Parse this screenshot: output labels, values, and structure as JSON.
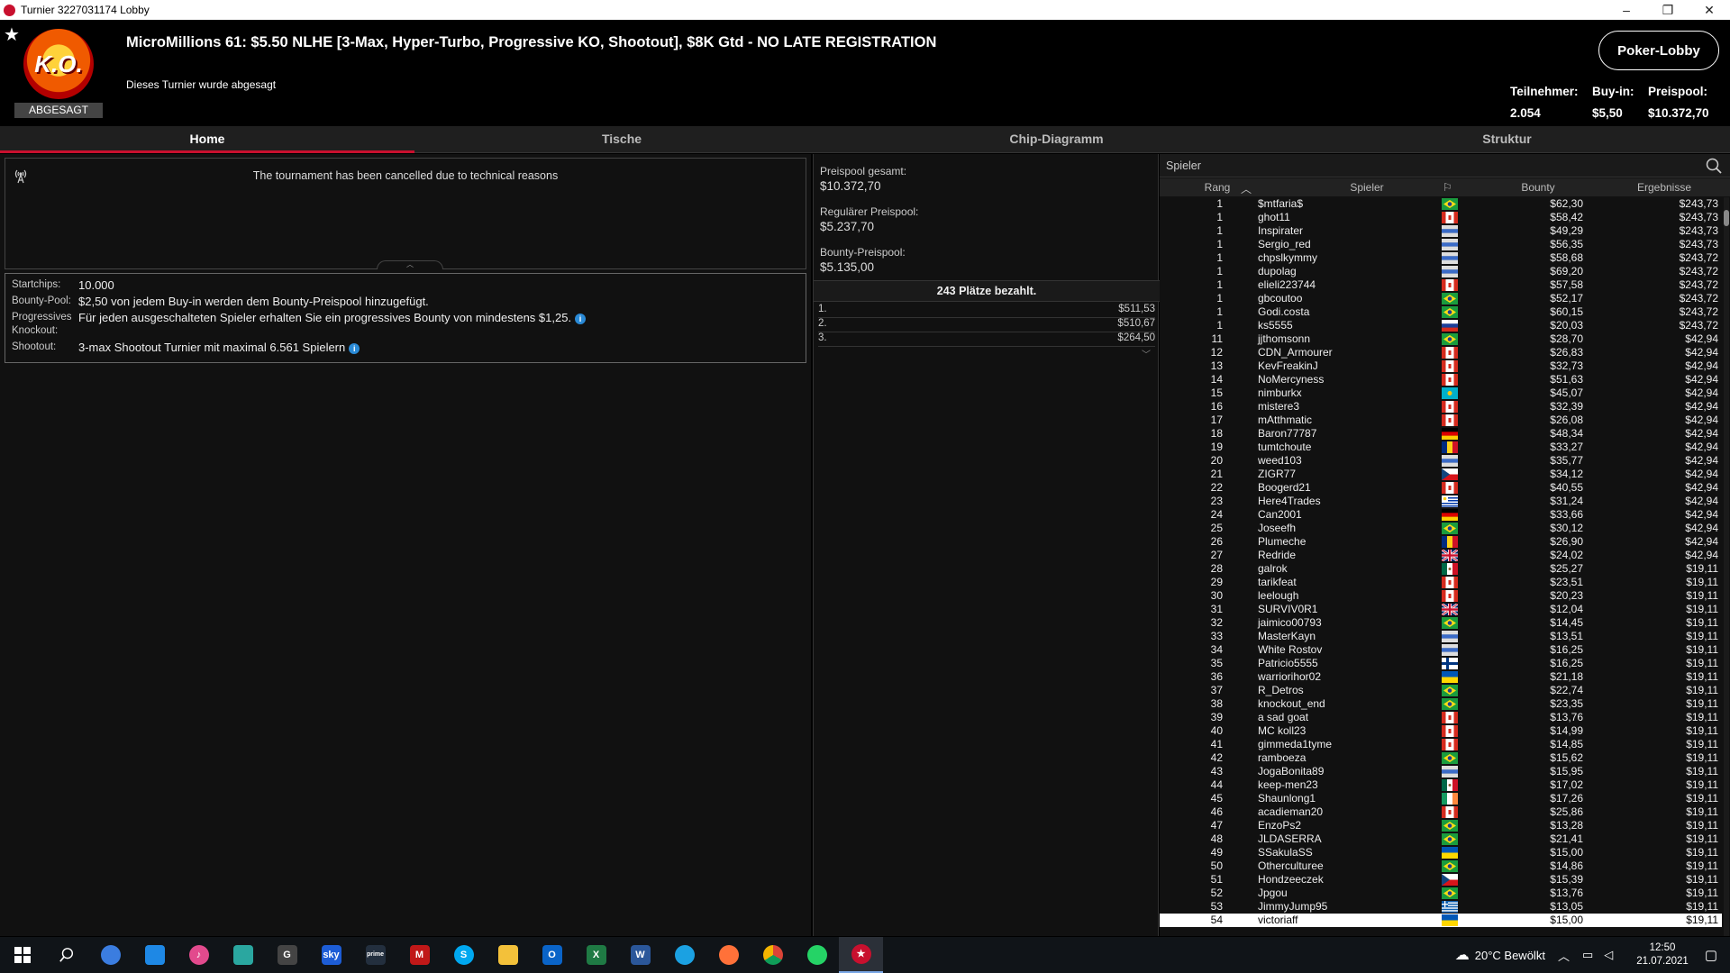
{
  "window": {
    "title": "Turnier 3227031174 Lobby",
    "controls": [
      "–",
      "❐",
      "✕"
    ]
  },
  "header": {
    "title": "MicroMillions 61: $5.50 NLHE [3-Max, Hyper-Turbo, Progressive KO, Shootout], $8K Gtd - NO LATE REGISTRATION",
    "subtitle": "Dieses Turnier wurde abgesagt",
    "logo_text": "K.O.",
    "status": "ABGESAGT",
    "lobby_button": "Poker-Lobby",
    "stats": [
      {
        "label": "Teilnehmer:",
        "value": "2.054"
      },
      {
        "label": "Buy-in:",
        "value": "$5,50"
      },
      {
        "label": "Preispool:",
        "value": "$10.372,70"
      }
    ]
  },
  "tabs": [
    "Home",
    "Tische",
    "Chip-Diagramm",
    "Struktur"
  ],
  "news": {
    "text": "The tournament has been cancelled due to technical reasons"
  },
  "info": [
    {
      "label": "Startchips:",
      "value": "10.000",
      "info": false
    },
    {
      "label": "Bounty-Pool:",
      "value": "$2,50 von jedem Buy-in werden dem Bounty-Preispool hinzugefügt.",
      "info": false
    },
    {
      "label": "Progressives Knockout:",
      "value": "Für jeden ausgeschalteten Spieler erhalten Sie ein progressives Bounty von mindestens $1,25.",
      "info": true
    },
    {
      "label": "Shootout:",
      "value": "3-max Shootout Turnier mit maximal 6.561 Spielern",
      "info": true
    }
  ],
  "prizepool": {
    "total_label": "Preispool gesamt:",
    "total": "$10.372,70",
    "regular_label": "Regulärer Preispool:",
    "regular": "$5.237,70",
    "bounty_label": "Bounty-Preispool:",
    "bounty": "$5.135,00",
    "paid_header": "243 Plätze bezahlt.",
    "payouts": [
      {
        "place": "1.",
        "amount": "$511,53"
      },
      {
        "place": "2.",
        "amount": "$510,67"
      },
      {
        "place": "3.",
        "amount": "$264,50"
      }
    ]
  },
  "players": {
    "search_label": "Spieler",
    "columns": {
      "rank": "Rang",
      "name": "Spieler",
      "bounty": "Bounty",
      "result": "Ergebnisse"
    },
    "rows": [
      [
        "1",
        "$mtfaria$",
        "br",
        "$62,30",
        "$243,73"
      ],
      [
        "1",
        "ghot11",
        "ca",
        "$58,42",
        "$243,73"
      ],
      [
        "1",
        "Inspirater",
        "gen",
        "$49,29",
        "$243,73"
      ],
      [
        "1",
        "Sergio_red",
        "gen",
        "$56,35",
        "$243,73"
      ],
      [
        "1",
        "chpslkymmy",
        "gen",
        "$58,68",
        "$243,72"
      ],
      [
        "1",
        "dupolag",
        "gen",
        "$69,20",
        "$243,72"
      ],
      [
        "1",
        "elieli223744",
        "ca",
        "$57,58",
        "$243,72"
      ],
      [
        "1",
        "gbcoutoo",
        "br",
        "$52,17",
        "$243,72"
      ],
      [
        "1",
        "Godi.costa",
        "br",
        "$60,15",
        "$243,72"
      ],
      [
        "1",
        "ks5555",
        "ru",
        "$20,03",
        "$243,72"
      ],
      [
        "11",
        "jjthomsonn",
        "br",
        "$28,70",
        "$42,94"
      ],
      [
        "12",
        "CDN_Armourer",
        "ca",
        "$26,83",
        "$42,94"
      ],
      [
        "13",
        "KevFreakinJ",
        "ca",
        "$32,73",
        "$42,94"
      ],
      [
        "14",
        "NoMercyness",
        "ca",
        "$51,63",
        "$42,94"
      ],
      [
        "15",
        "nimburkx",
        "kz",
        "$45,07",
        "$42,94"
      ],
      [
        "16",
        "mistere3",
        "ca",
        "$32,39",
        "$42,94"
      ],
      [
        "17",
        "mAtthmatic",
        "ca",
        "$26,08",
        "$42,94"
      ],
      [
        "18",
        "Baron77787",
        "de",
        "$48,34",
        "$42,94"
      ],
      [
        "19",
        "tumtchoute",
        "ro",
        "$33,27",
        "$42,94"
      ],
      [
        "20",
        "weed103",
        "gen",
        "$35,77",
        "$42,94"
      ],
      [
        "21",
        "ZIGR77",
        "cz",
        "$34,12",
        "$42,94"
      ],
      [
        "22",
        "Boogerd21",
        "ca",
        "$40,55",
        "$42,94"
      ],
      [
        "23",
        "Here4Trades",
        "uy",
        "$31,24",
        "$42,94"
      ],
      [
        "24",
        "Can2001",
        "de",
        "$33,66",
        "$42,94"
      ],
      [
        "25",
        "Joseefh",
        "br",
        "$30,12",
        "$42,94"
      ],
      [
        "26",
        "Plumeche",
        "ro",
        "$26,90",
        "$42,94"
      ],
      [
        "27",
        "Redride",
        "gb",
        "$24,02",
        "$42,94"
      ],
      [
        "28",
        "galrok",
        "mx",
        "$25,27",
        "$19,11"
      ],
      [
        "29",
        "tarikfeat",
        "ca",
        "$23,51",
        "$19,11"
      ],
      [
        "30",
        "leelough",
        "ca",
        "$20,23",
        "$19,11"
      ],
      [
        "31",
        "SURVIV0R1",
        "gb",
        "$12,04",
        "$19,11"
      ],
      [
        "32",
        "jaimico00793",
        "br",
        "$14,45",
        "$19,11"
      ],
      [
        "33",
        "MasterKayn",
        "gen",
        "$13,51",
        "$19,11"
      ],
      [
        "34",
        "White Rostov",
        "gen",
        "$16,25",
        "$19,11"
      ],
      [
        "35",
        "Patricio5555",
        "fi",
        "$16,25",
        "$19,11"
      ],
      [
        "36",
        "warriorihor02",
        "ua",
        "$21,18",
        "$19,11"
      ],
      [
        "37",
        "R_Detros",
        "br",
        "$22,74",
        "$19,11"
      ],
      [
        "38",
        "knockout_end",
        "br",
        "$23,35",
        "$19,11"
      ],
      [
        "39",
        "a sad goat",
        "ca",
        "$13,76",
        "$19,11"
      ],
      [
        "40",
        "MC koll23",
        "ca",
        "$14,99",
        "$19,11"
      ],
      [
        "41",
        "gimmeda1tyme",
        "ca",
        "$14,85",
        "$19,11"
      ],
      [
        "42",
        "ramboeza",
        "br",
        "$15,62",
        "$19,11"
      ],
      [
        "43",
        "JogaBonita89",
        "gen",
        "$15,95",
        "$19,11"
      ],
      [
        "44",
        "keep-men23",
        "mx",
        "$17,02",
        "$19,11"
      ],
      [
        "45",
        "Shaunlong1",
        "ie",
        "$17,26",
        "$19,11"
      ],
      [
        "46",
        "acadieman20",
        "ca",
        "$25,86",
        "$19,11"
      ],
      [
        "47",
        "EnzoPs2",
        "br",
        "$13,28",
        "$19,11"
      ],
      [
        "48",
        "JLDASERRA",
        "br",
        "$21,41",
        "$19,11"
      ],
      [
        "49",
        "SSakulaSS",
        "ua",
        "$15,00",
        "$19,11"
      ],
      [
        "50",
        "Otherculturee",
        "br",
        "$14,86",
        "$19,11"
      ],
      [
        "51",
        "Hondzeeczek",
        "cz",
        "$15,39",
        "$19,11"
      ],
      [
        "52",
        "Jpgou",
        "br",
        "$13,76",
        "$19,11"
      ],
      [
        "53",
        "JimmyJump95",
        "gr",
        "$13,05",
        "$19,11"
      ],
      [
        "54",
        "victoriaff",
        "ua",
        "$15,00",
        "$19,11"
      ]
    ]
  },
  "taskbar": {
    "apps": [
      "start",
      "search",
      "cortana",
      "onedrive",
      "itunes",
      "edge-dev",
      "gog",
      "sky",
      "prime",
      "mcafee",
      "skype",
      "explorer",
      "outlook",
      "excel",
      "word",
      "edge",
      "firefox",
      "chrome",
      "whatsapp",
      "pokerstars"
    ],
    "weather": "20°C  Bewölkt",
    "time": "12:50",
    "date": "21.07.2021"
  }
}
